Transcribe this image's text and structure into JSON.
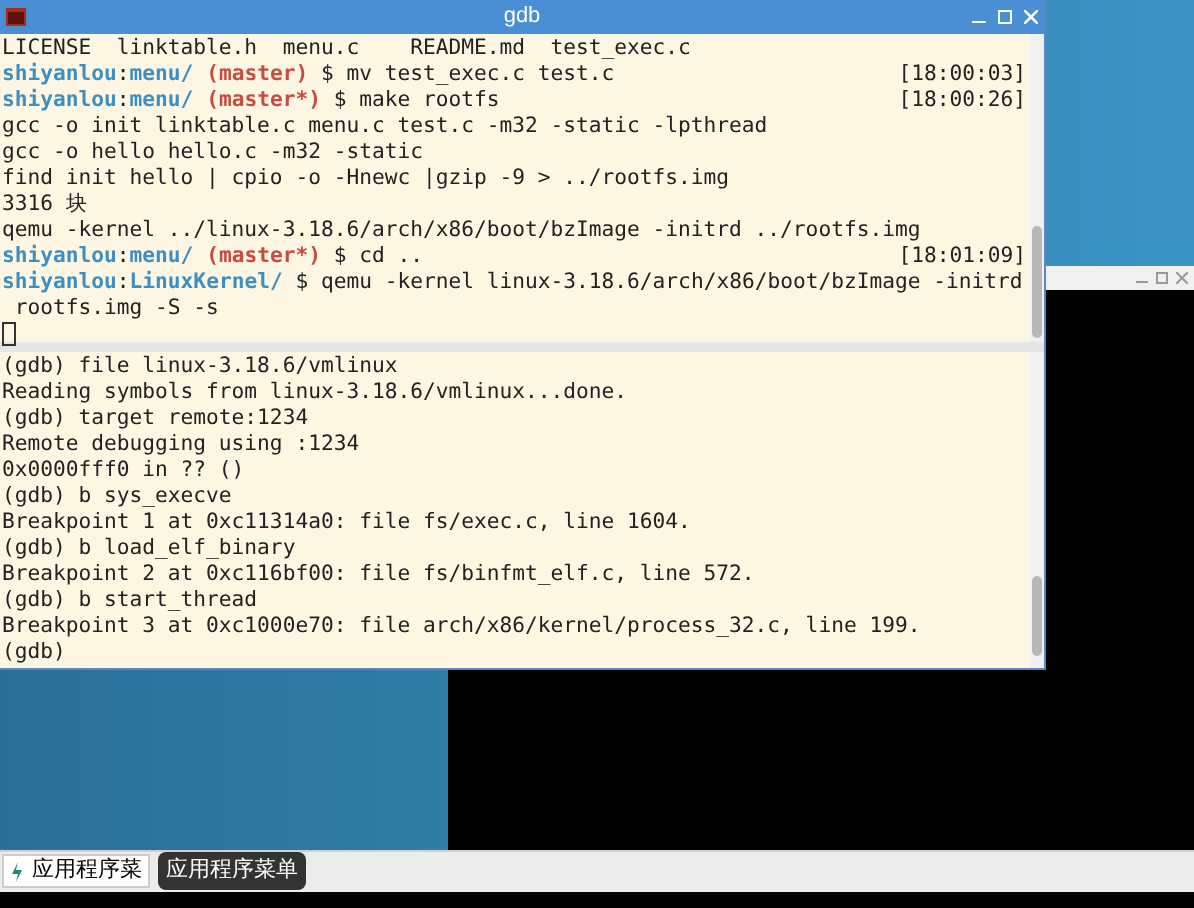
{
  "window": {
    "title": "gdb"
  },
  "upper_pane": {
    "lines": [
      {
        "segments": [
          {
            "kind": "plain",
            "text": "LICENSE  linktable.h  menu.c    README.md  test_exec.c"
          }
        ]
      },
      {
        "segments": [
          {
            "kind": "user",
            "text": "shiyanlou"
          },
          {
            "kind": "plain",
            "text": ":"
          },
          {
            "kind": "path",
            "text": "menu/"
          },
          {
            "kind": "branch",
            "text": " (master)"
          },
          {
            "kind": "plain",
            "text": " $ mv test_exec.c test.c"
          }
        ],
        "time": "[18:00:03]"
      },
      {
        "segments": [
          {
            "kind": "user",
            "text": "shiyanlou"
          },
          {
            "kind": "plain",
            "text": ":"
          },
          {
            "kind": "path",
            "text": "menu/"
          },
          {
            "kind": "branch",
            "text": " (master*)"
          },
          {
            "kind": "plain",
            "text": " $ make rootfs"
          }
        ],
        "time": "[18:00:26]"
      },
      {
        "segments": [
          {
            "kind": "plain",
            "text": "gcc -o init linktable.c menu.c test.c -m32 -static -lpthread"
          }
        ]
      },
      {
        "segments": [
          {
            "kind": "plain",
            "text": "gcc -o hello hello.c -m32 -static"
          }
        ]
      },
      {
        "segments": [
          {
            "kind": "plain",
            "text": "find init hello | cpio -o -Hnewc |gzip -9 > ../rootfs.img"
          }
        ]
      },
      {
        "segments": [
          {
            "kind": "plain",
            "text": "3316 块"
          }
        ]
      },
      {
        "segments": [
          {
            "kind": "plain",
            "text": "qemu -kernel ../linux-3.18.6/arch/x86/boot/bzImage -initrd ../rootfs.img"
          }
        ]
      },
      {
        "segments": [
          {
            "kind": "user",
            "text": "shiyanlou"
          },
          {
            "kind": "plain",
            "text": ":"
          },
          {
            "kind": "path",
            "text": "menu/"
          },
          {
            "kind": "branch",
            "text": " (master*)"
          },
          {
            "kind": "plain",
            "text": " $ cd .."
          }
        ],
        "time": "[18:01:09]"
      },
      {
        "segments": [
          {
            "kind": "user",
            "text": "shiyanlou"
          },
          {
            "kind": "plain",
            "text": ":"
          },
          {
            "kind": "path",
            "text": "LinuxKernel/"
          },
          {
            "kind": "plain",
            "text": " $ qemu -kernel linux-3.18.6/arch/x86/boot/bzImage -initrd"
          }
        ]
      },
      {
        "segments": [
          {
            "kind": "plain",
            "text": " rootfs.img -S -s"
          }
        ]
      }
    ]
  },
  "lower_pane": {
    "lines": [
      "(gdb) file linux-3.18.6/vmlinux",
      "Reading symbols from linux-3.18.6/vmlinux...done.",
      "(gdb) target remote:1234",
      "Remote debugging using :1234",
      "0x0000fff0 in ?? ()",
      "(gdb) b sys_execve",
      "Breakpoint 1 at 0xc11314a0: file fs/exec.c, line 1604.",
      "(gdb) b load_elf_binary",
      "Breakpoint 2 at 0xc116bf00: file fs/binfmt_elf.c, line 572.",
      "(gdb) b start_thread",
      "Breakpoint 3 at 0xc1000e70: file arch/x86/kernel/process_32.c, line 199.",
      "(gdb)"
    ]
  },
  "taskbar": {
    "start_button": "应用程序菜",
    "tooltip": "应用程序菜单"
  }
}
